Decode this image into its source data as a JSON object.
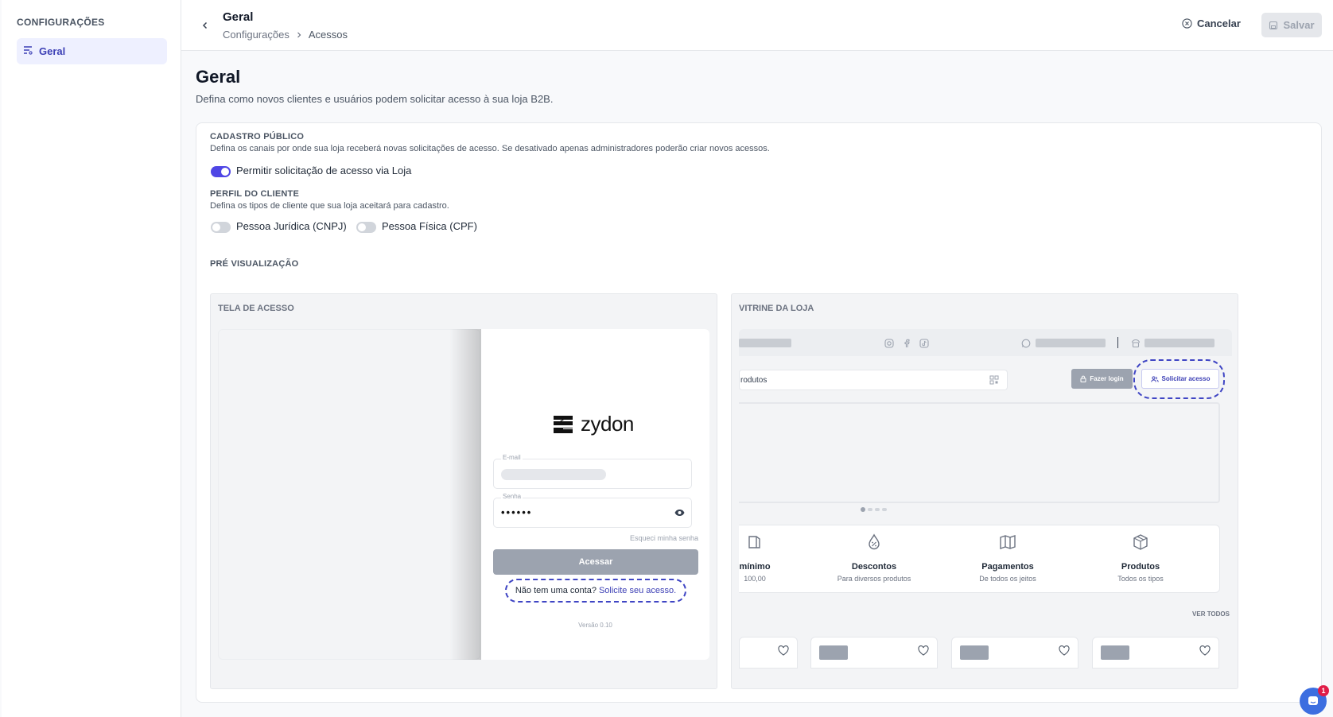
{
  "sidebar": {
    "title": "CONFIGURAÇÕES",
    "items": [
      {
        "label": "Geral",
        "icon": "filter-list-icon",
        "active": true
      }
    ]
  },
  "header": {
    "title": "Geral",
    "breadcrumb": [
      "Configurações",
      "Acessos"
    ],
    "cancel_label": "Cancelar",
    "save_label": "Salvar"
  },
  "page": {
    "heading": "Geral",
    "description": "Defina como novos clientes e usuários podem solicitar acesso à sua loja B2B."
  },
  "cadastro": {
    "title": "CADASTRO PÚBLICO",
    "description": "Defina os canais por onde sua loja receberá novas solicitações de acesso. Se desativado apenas administradores poderão criar novos acessos.",
    "toggle_label": "Permitir solicitação de acesso via Loja",
    "toggle_on": true
  },
  "perfil": {
    "title": "PERFIL DO CLIENTE",
    "description": "Defina os tipos de cliente que sua loja aceitará para cadastro.",
    "options": [
      {
        "label": "Pessoa Jurídica (CNPJ)",
        "on": false
      },
      {
        "label": "Pessoa Física (CPF)",
        "on": false
      }
    ]
  },
  "preview": {
    "title": "PRÉ VISUALIZAÇÃO",
    "login": {
      "title": "TELA DE ACESSO",
      "logo_text": "zydon",
      "email_label": "E-mail",
      "password_label": "Senha",
      "password_value": "••••••",
      "forgot": "Esqueci minha senha",
      "submit": "Acessar",
      "no_account": "Não tem uma conta?",
      "request_link": "Solicite seu acesso.",
      "version": "Versão 0.10"
    },
    "store": {
      "title": "VITRINE DA LOJA",
      "search_text": "rodutos",
      "login_button": "Fazer login",
      "request_button": "Solicitar acesso",
      "benefits": [
        {
          "icon": "wallet-icon",
          "title": "mínimo",
          "subtitle": "100,00"
        },
        {
          "icon": "discount-drop-icon",
          "title": "Descontos",
          "subtitle": "Para diversos produtos"
        },
        {
          "icon": "map-icon",
          "title": "Pagamentos",
          "subtitle": "De todos os jeitos"
        },
        {
          "icon": "box-icon",
          "title": "Produtos",
          "subtitle": "Todos os tipos"
        }
      ],
      "see_all": "VER TODOS"
    }
  },
  "chat": {
    "badge": "1"
  },
  "colors": {
    "accent": "#4f46e5",
    "link": "#3c3fb5",
    "disabled": "#9ca3af"
  }
}
